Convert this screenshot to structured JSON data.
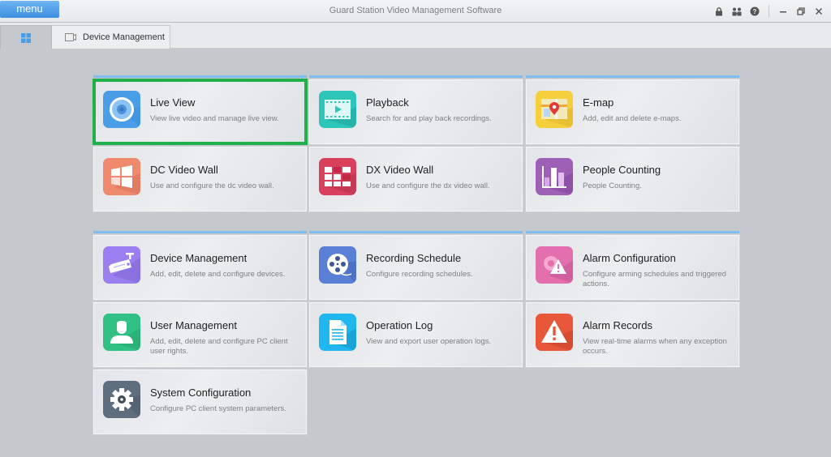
{
  "titlebar": {
    "menu_label": "menu",
    "app_title": "Guard Station Video Management Software",
    "icons": [
      "lock-icon",
      "user-switch-icon",
      "help-icon",
      "minimize-icon",
      "restore-icon",
      "close-icon"
    ]
  },
  "tabs": [
    {
      "name": "home",
      "icon": "grid-icon",
      "label": ""
    },
    {
      "name": "device-management",
      "icon": "camera-icon",
      "label": "Device Management"
    }
  ],
  "selected_tile": "live-view",
  "groups": [
    {
      "tiles": [
        {
          "id": "live-view",
          "title": "Live View",
          "desc": "View live video and manage live view.",
          "icon": "live-view-icon",
          "color": "#4a9ee8"
        },
        {
          "id": "playback",
          "title": "Playback",
          "desc": "Search for and play back recordings.",
          "icon": "playback-icon",
          "color": "#2ec6b9"
        },
        {
          "id": "e-map",
          "title": "E-map",
          "desc": "Add, edit and delete e-maps.",
          "icon": "e-map-icon",
          "color": "#f6cf3c"
        },
        {
          "id": "dc-video-wall",
          "title": "DC Video Wall",
          "desc": "Use and configure the dc video wall.",
          "icon": "dc-video-wall-icon",
          "color": "#f08a6e"
        },
        {
          "id": "dx-video-wall",
          "title": "DX Video Wall",
          "desc": "Use and configure the dx video wall.",
          "icon": "dx-video-wall-icon",
          "color": "#d9405e"
        },
        {
          "id": "people-counting",
          "title": "People Counting",
          "desc": "People Counting.",
          "icon": "people-counting-icon",
          "color": "#9e5fb6"
        }
      ]
    },
    {
      "tiles": [
        {
          "id": "device-management",
          "title": "Device Management",
          "desc": "Add, edit, delete and configure devices.",
          "icon": "device-management-icon",
          "color": "#9b7ff0"
        },
        {
          "id": "recording-schedule",
          "title": "Recording Schedule",
          "desc": "Configure recording schedules.",
          "icon": "recording-schedule-icon",
          "color": "#5a7fd6"
        },
        {
          "id": "alarm-configuration",
          "title": "Alarm Configuration",
          "desc": "Configure arming schedules and triggered actions.",
          "icon": "alarm-configuration-icon",
          "color": "#e46fae"
        },
        {
          "id": "user-management",
          "title": "User Management",
          "desc": "Add, edit, delete and configure PC client user rights.",
          "icon": "user-management-icon",
          "color": "#32c184"
        },
        {
          "id": "operation-log",
          "title": "Operation Log",
          "desc": "View and export user operation logs.",
          "icon": "operation-log-icon",
          "color": "#1fb7ee"
        },
        {
          "id": "alarm-records",
          "title": "Alarm Records",
          "desc": "View real-time alarms when any exception occurs.",
          "icon": "alarm-records-icon",
          "color": "#e9573a"
        },
        {
          "id": "system-configuration",
          "title": "System Configuration",
          "desc": "Configure PC client system parameters.",
          "icon": "system-configuration-icon",
          "color": "#5f6e7f"
        }
      ]
    }
  ]
}
